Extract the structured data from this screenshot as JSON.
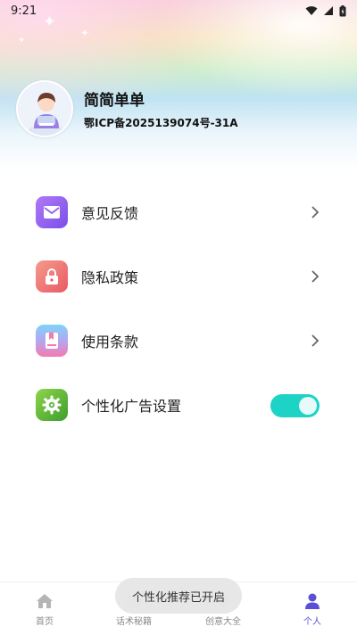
{
  "status_bar": {
    "time": "9:21",
    "wifi_icon": "wifi-icon",
    "signal_icon": "signal-icon",
    "battery_icon": "battery-charging-icon"
  },
  "profile": {
    "name": "简简单单",
    "icp": "鄂ICP备2025139074号-31A",
    "avatar_icon": "avatar-illustration"
  },
  "menu": {
    "items": [
      {
        "label": "意见反馈",
        "icon": "mail-icon",
        "color": "#8d5cf0",
        "trailing": "chevron"
      },
      {
        "label": "隐私政策",
        "icon": "lock-icon",
        "color": "#f06a6a",
        "trailing": "chevron"
      },
      {
        "label": "使用条款",
        "icon": "book-icon",
        "color": "#f57aa8",
        "trailing": "chevron"
      },
      {
        "label": "个性化广告设置",
        "icon": "gear-icon",
        "color": "#59b83a",
        "trailing": "toggle",
        "toggle_on": true
      }
    ]
  },
  "tabbar": {
    "tabs": [
      {
        "label": "首页",
        "icon": "home-icon",
        "active": false
      },
      {
        "label": "话术秘籍",
        "icon": "book-tab-icon",
        "active": false
      },
      {
        "label": "创意大全",
        "icon": "idea-tab-icon",
        "active": false
      },
      {
        "label": "个人",
        "icon": "person-icon",
        "active": true
      }
    ]
  },
  "toast": {
    "text": "个性化推荐已开启"
  },
  "colors": {
    "accent": "#5b4fd6",
    "toggle_on": "#1dd3c5"
  }
}
